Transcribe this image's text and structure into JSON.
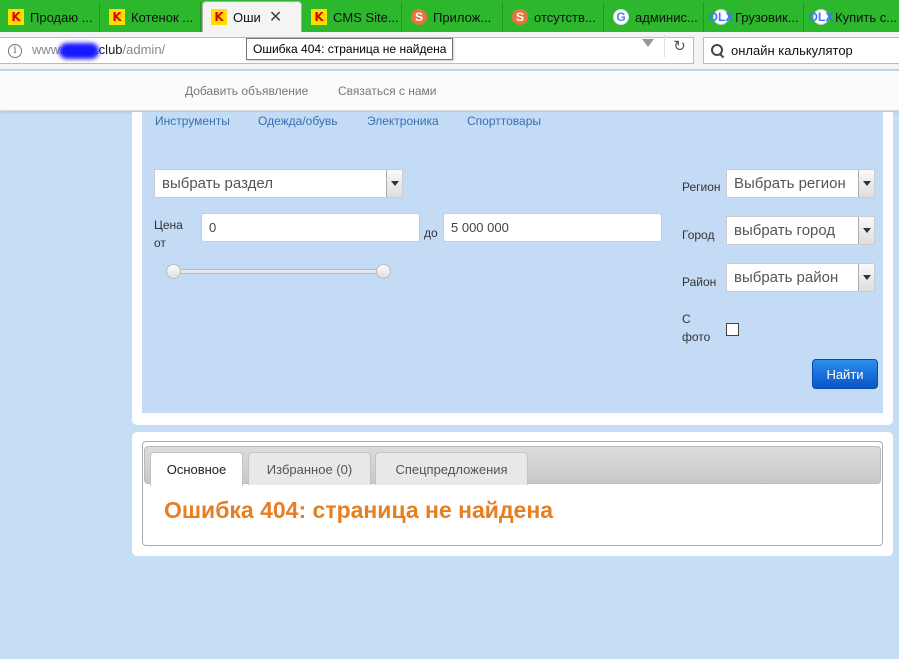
{
  "browser": {
    "tabs": [
      {
        "label": "Продаю ...",
        "favicon": "K",
        "favicon_type": "k",
        "active": false
      },
      {
        "label": "Котенок ...",
        "favicon": "K",
        "favicon_type": "k",
        "active": false
      },
      {
        "label": "Оши",
        "favicon": "K",
        "favicon_type": "k",
        "active": true
      },
      {
        "label": "CMS Site...",
        "favicon": "K",
        "favicon_type": "k",
        "active": false
      },
      {
        "label": "Прилож...",
        "favicon": "S",
        "favicon_type": "s",
        "active": false
      },
      {
        "label": "отсутств...",
        "favicon": "S",
        "favicon_type": "s",
        "active": false
      },
      {
        "label": "админис...",
        "favicon": "G",
        "favicon_type": "g",
        "active": false
      },
      {
        "label": "Грузовик...",
        "favicon": "OLX",
        "favicon_type": "olx",
        "active": false
      },
      {
        "label": "Купить с...",
        "favicon": "OLX",
        "favicon_type": "olx",
        "active": false
      }
    ],
    "url": {
      "prefix": "www.",
      "domain_suffix": ".club",
      "path": "/admin/"
    },
    "tooltip": "Ошибка 404: страница не найдена",
    "search_value": "онлайн калькулятор"
  },
  "site_nav": {
    "add_ad": "Добавить объявление",
    "contact": "Связаться с нами"
  },
  "categories": [
    "Инструменты",
    "Одежда/обувь",
    "Электроника",
    "Спорттовары"
  ],
  "filters": {
    "section_select": "выбрать раздел",
    "price_label": "Цена",
    "from_label": "от",
    "to_label": "до",
    "price_from": "0",
    "price_to": "5 000 000",
    "region_label": "Регион",
    "region_select": "Выбрать регион",
    "city_label": "Город",
    "city_select": "выбрать город",
    "district_label": "Район",
    "district_select": "выбрать район",
    "photo_label_1": "С",
    "photo_label_2": "фото",
    "find_button": "Найти"
  },
  "results": {
    "tabs": [
      "Основное",
      "Избранное (0)",
      "Спецпредложения"
    ],
    "error_message": "Ошибка 404: страница не найдена"
  },
  "colors": {
    "tab_strip": "#2cb72c",
    "page_bg": "#c5ddf5",
    "accent_orange": "#e67e22",
    "button_blue": "#0b55c6"
  }
}
